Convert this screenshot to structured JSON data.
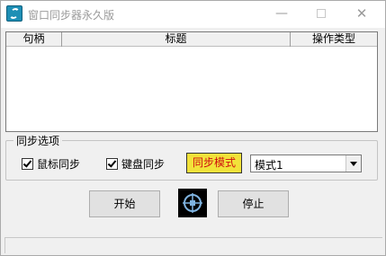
{
  "window": {
    "title": "窗口同步器永久版",
    "controls": {
      "minimize": "—",
      "close": "✕"
    }
  },
  "list": {
    "columns": [
      "句柄",
      "标题",
      "操作类型"
    ],
    "rows": []
  },
  "options": {
    "group_title": "同步选项",
    "mouse_sync": {
      "label": "鼠标同步",
      "checked": true
    },
    "keyboard_sync": {
      "label": "键盘同步",
      "checked": true
    },
    "mode_badge": "同步模式",
    "mode_select": {
      "value": "模式1"
    }
  },
  "buttons": {
    "start": "开始",
    "stop": "停止"
  },
  "colors": {
    "mode_badge_bg": "#f2e23a",
    "mode_badge_text": "#d01010",
    "icon_bg": "#1e8fb5"
  },
  "icons": {
    "app": "sync-app-icon",
    "target": "crosshair-target-icon"
  }
}
